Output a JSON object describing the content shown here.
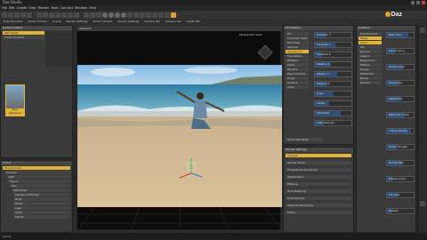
{
  "app": {
    "title": "Daz Studio",
    "menu": [
      "File",
      "Edit",
      "Create",
      "View",
      "Render",
      "Tools",
      "Connect",
      "Window",
      "Help"
    ],
    "logo_text": "Daz",
    "accent": "#e0b43a",
    "selection_blue": "#2d4f7a"
  },
  "tabs": [
    "Hide Favorites",
    "Smart Content",
    "Scene",
    "Render Settings",
    "Smart Content",
    "Render Settings",
    "Surface Tab",
    "Camera Tab",
    "Lights Tab"
  ],
  "left_panel": {
    "title": "Smart Content",
    "items": [
      "Wet Folder",
      "Smart Content"
    ],
    "thumb_caption": "Wavy Swimwear"
  },
  "scene_panel": {
    "title": "Scene",
    "items": [
      "Environment",
      "Camera",
      "Light",
      "Figure",
      "Hair",
      "Swimwear",
      "Genesis 8 Female",
      "Body",
      "Head",
      "Legs",
      "Arms",
      "Hands"
    ]
  },
  "viewport": {
    "title": "Viewport",
    "camera_label": "Perspective View"
  },
  "params_panel": {
    "title": "Parameters",
    "left_items": [
      "All",
      "Currently Used",
      "Favorites",
      "General",
      "Transforms",
      "Translation",
      "Rotation",
      "Scale",
      "Morphs",
      "Pose Controls",
      "Props",
      "Surface",
      "Actor"
    ],
    "sliders": [
      {
        "label": "Translate X",
        "value": 0.3
      },
      {
        "label": "Translate Y",
        "value": 0.55
      },
      {
        "label": "Translate Z",
        "value": 0.2
      },
      {
        "label": "Rotation X",
        "value": 0.45
      },
      {
        "label": "Rotation Y",
        "value": 0.6
      },
      {
        "label": "Rotation Z",
        "value": 0.35
      },
      {
        "label": "Scale",
        "value": 0.5
      },
      {
        "label": "Visible",
        "value": 0.4
      },
      {
        "label": "Selectable",
        "value": 0.7
      },
      {
        "label": "Cast Shadows",
        "value": 0.25
      }
    ],
    "footer": "Show Sub Items"
  },
  "surfaces_panel": {
    "title": "Surfaces",
    "items": [
      "Environment",
      "Water",
      "Sand",
      "Sky",
      "Ground",
      "Lagoon",
      "Base Color",
      "Diffuse",
      "Glossy",
      "Refraction",
      "Bump",
      "Normal"
    ],
    "sliders": [
      {
        "label": "Base Color",
        "value": 0.8
      },
      {
        "label": "Translucency",
        "value": 0.3
      },
      {
        "label": "Glossy Layer",
        "value": 0.6
      },
      {
        "label": "Roughness",
        "value": 0.45
      },
      {
        "label": "Reflectivity",
        "value": 0.5
      },
      {
        "label": "Refraction Index",
        "value": 0.65
      },
      {
        "label": "Cutout Opacity",
        "value": 0.9
      },
      {
        "label": "Bump Strength",
        "value": 0.35
      },
      {
        "label": "Normal Map",
        "value": 0.55
      },
      {
        "label": "Displacement",
        "value": 0.2
      },
      {
        "label": "Top Coat",
        "value": 0.4
      },
      {
        "label": "Metallic",
        "value": 0.15
      }
    ]
  },
  "render_panel": {
    "title": "Render Settings",
    "items": [
      "General",
      "Render Mode",
      "Progressive Rendering",
      "Optimization",
      "Filtering",
      "Tone Mapping",
      "Environment",
      "Spectral Rendering",
      "Editor"
    ]
  },
  "statusbar": "Ready"
}
